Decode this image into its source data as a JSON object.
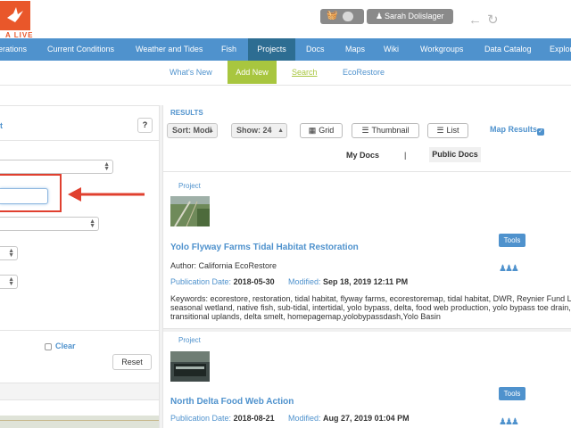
{
  "header": {
    "logo_text": "A LIVE",
    "user_name": "Sarah Dolislager"
  },
  "main_nav": [
    {
      "label": "erations"
    },
    {
      "label": "Current Conditions"
    },
    {
      "label": "Weather and Tides"
    },
    {
      "label": "Fish"
    },
    {
      "label": "Projects"
    },
    {
      "label": "Docs"
    },
    {
      "label": "Maps"
    },
    {
      "label": "Wiki"
    },
    {
      "label": "Workgroups"
    },
    {
      "label": "Data Catalog"
    },
    {
      "label": "Explor"
    }
  ],
  "sub_nav": {
    "whats_new": "What's New",
    "add_new": "Add New",
    "search": "Search",
    "ecorestore": "EcoRestore"
  },
  "left_panel": {
    "header_title": "t",
    "help": "?",
    "clear": "Clear",
    "reset": "Reset"
  },
  "results": {
    "title": "RESULTS",
    "sort": "Sort: Modi",
    "show": "Show: 24",
    "grid": "Grid",
    "thumbnail": "Thumbnail",
    "list": "List",
    "map_results": "Map Results",
    "my_docs": "My Docs",
    "separator": "|",
    "public_docs": "Public Docs",
    "items": [
      {
        "type": "Project",
        "title": "Yolo Flyway Farms Tidal Habitat Restoration",
        "author": "Author: California EcoRestore",
        "pub_label": "Publication Date:",
        "pub_date": "2018-05-30",
        "mod_label": "Modified:",
        "mod_date": "Sep 18, 2019 12:11 PM",
        "tools": "Tools",
        "keywords_1": "Keywords: ecorestore, restoration, tidal habitat, flyway farms, ecorestoremap, tidal habitat, DWR, Reynier Fund LLC,",
        "keywords_2": "seasonal wetland, native fish, sub-tidal, intertidal, yolo bypass, delta, food web production, yolo bypass toe drain,",
        "keywords_3": "transitional uplands, delta smelt, homepagemap,yolobypassdash,Yolo Basin"
      },
      {
        "type": "Project",
        "title": "North Delta Food Web Action",
        "pub_label": "Publication Date:",
        "pub_date": "2018-08-21",
        "mod_label": "Modified:",
        "mod_date": "Aug 27, 2019 01:04 PM",
        "tools": "Tools"
      }
    ]
  },
  "colors": {
    "nav_blue": "#4f92cd",
    "nav_active": "#2d6d92",
    "add_new_green": "#a8c63f",
    "highlight_red": "#e0402f",
    "brand_orange": "#e9572a"
  },
  "icons": {
    "logo": "bird-logo-icon",
    "cart": "basket-icon",
    "user": "user-icon",
    "back": "back-arrow-icon",
    "refresh": "refresh-icon",
    "grid": "grid-icon",
    "list": "list-icon",
    "group": "group-icon"
  }
}
